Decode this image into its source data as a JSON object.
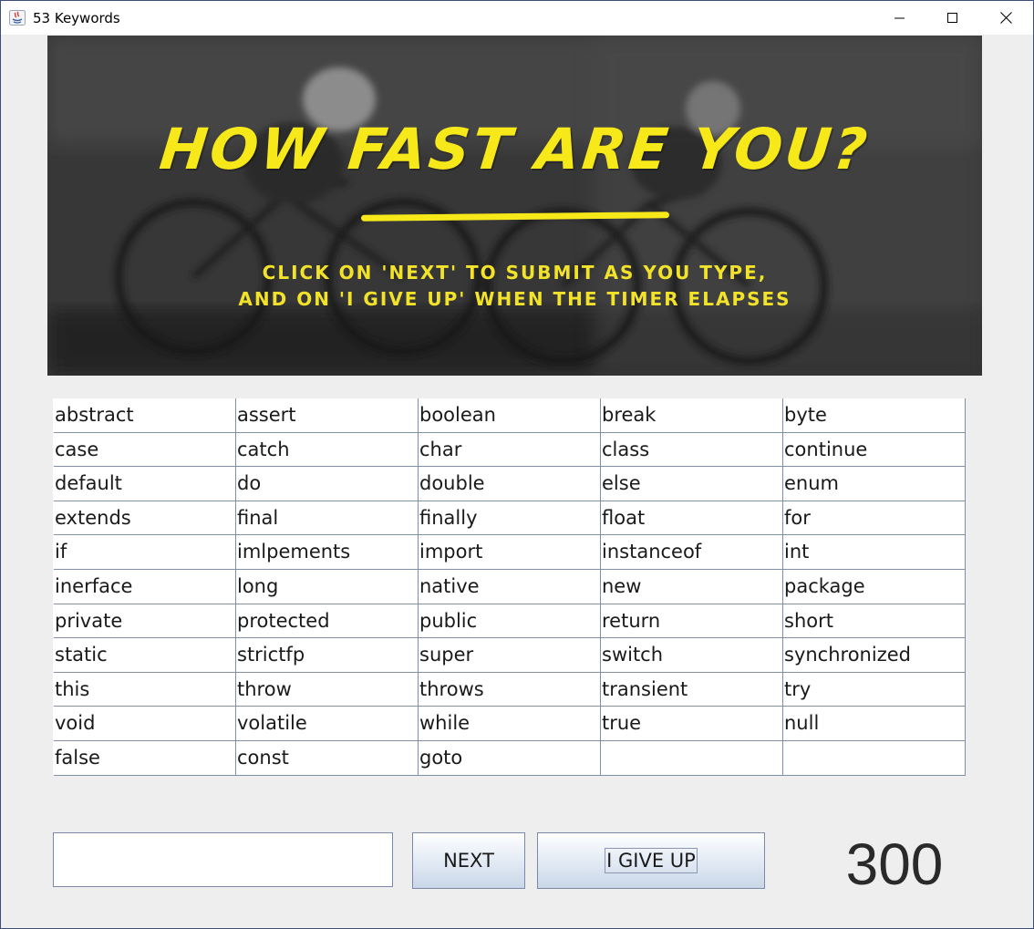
{
  "window": {
    "title": "53 Keywords",
    "icons": [
      "java-app-icon",
      "minimize-icon",
      "maximize-icon",
      "close-icon"
    ]
  },
  "banner": {
    "headline": "How fast are you?",
    "instruction_line1": "CLICK ON 'NEXT' TO SUBMIT AS YOU TYPE,",
    "instruction_line2": "AND ON 'I GIVE UP' WHEN THE TIMER ELAPSES",
    "accent_color": "#f7e81a"
  },
  "keywords": [
    [
      "abstract",
      "assert",
      "boolean",
      "break",
      "byte"
    ],
    [
      "case",
      "catch",
      "char",
      "class",
      "continue"
    ],
    [
      "default",
      "do",
      "double",
      "else",
      "enum"
    ],
    [
      "extends",
      "final",
      "finally",
      "float",
      "for"
    ],
    [
      "if",
      "imlpements",
      "import",
      "instanceof",
      "int"
    ],
    [
      "inerface",
      "long",
      "native",
      "new",
      "package"
    ],
    [
      "private",
      "protected",
      "public",
      "return",
      "short"
    ],
    [
      "static",
      "strictfp",
      "super",
      "switch",
      "synchronized"
    ],
    [
      "this",
      "throw",
      "throws",
      "transient",
      "try"
    ],
    [
      "void",
      "volatile",
      "while",
      "true",
      "null"
    ],
    [
      "false",
      "const",
      "goto",
      "",
      ""
    ]
  ],
  "controls": {
    "answer_value": "",
    "answer_placeholder": "",
    "next_label": "NEXT",
    "giveup_label": "I GIVE UP",
    "timer": "300"
  }
}
